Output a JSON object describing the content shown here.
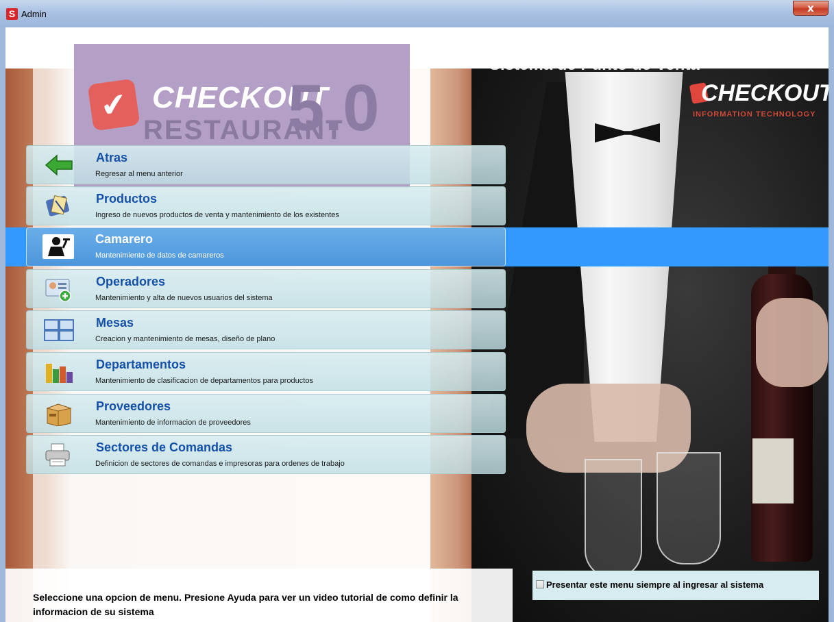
{
  "window": {
    "title": "Admin",
    "close_glyph": "x"
  },
  "branding": {
    "logo_word": "CHECKOUT",
    "logo_sub": "RESTAURANT",
    "logo_version": "5.0",
    "system_title": "Sistema de Punto de Venta",
    "brand_word": "CHECKOUT",
    "brand_sub": "INFORMATION TECHNOLOGY"
  },
  "menu": {
    "selected_index": 2,
    "items": [
      {
        "title": "Atras",
        "desc": "Regresar al menu anterior",
        "icon": "back-arrow-icon"
      },
      {
        "title": "Productos",
        "desc": "Ingreso de nuevos productos de venta y mantenimiento de los existentes",
        "icon": "products-icon"
      },
      {
        "title": "Camarero",
        "desc": "Mantenimiento de datos de camareros",
        "icon": "waiter-icon"
      },
      {
        "title": "Operadores",
        "desc": "Mantenimiento y alta de nuevos usuarios del sistema",
        "icon": "add-user-icon"
      },
      {
        "title": "Mesas",
        "desc": "Creacion y mantenimiento de mesas, diseño de plano",
        "icon": "tables-icon"
      },
      {
        "title": "Departamentos",
        "desc": "Mantenimiento de clasificacion de departamentos para productos",
        "icon": "departments-icon"
      },
      {
        "title": "Proveedores",
        "desc": "Mantenimiento de informacion de proveedores",
        "icon": "supplier-box-icon"
      },
      {
        "title": "Sectores de Comandas",
        "desc": "Definicion de sectores de comandas e impresoras para ordenes de  trabajo",
        "icon": "printer-icon"
      }
    ]
  },
  "footer": {
    "hint": "Seleccione una opcion de menu. Presione Ayuda para ver un video tutorial de como definir la informacion de su sistema",
    "show_menu_label": "Presentar este menu siempre al ingresar al sistema",
    "show_menu_checked": false
  },
  "colors": {
    "selection": "#3399ff",
    "title_blue": "#1550a8",
    "logo_bg": "#b49fc6"
  }
}
